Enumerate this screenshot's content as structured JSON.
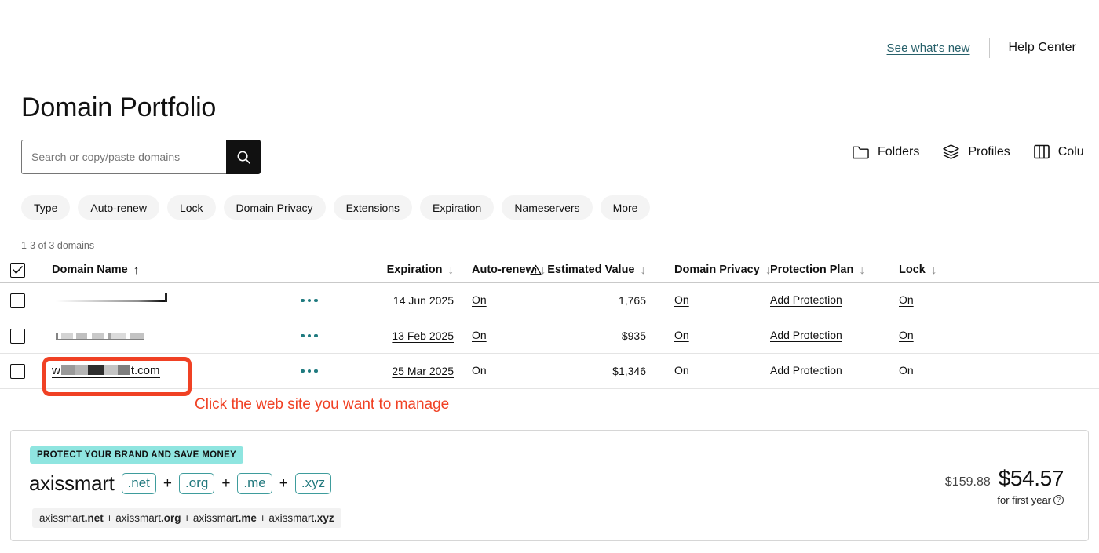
{
  "topbar": {
    "see_whats_new": "See what's new",
    "help_center": "Help Center"
  },
  "page_title": "Domain Portfolio",
  "search": {
    "placeholder": "Search or copy/paste domains",
    "value": "",
    "icon": "search-icon"
  },
  "actions": [
    {
      "label": "Folders",
      "icon": "folder-icon"
    },
    {
      "label": "Profiles",
      "icon": "layers-icon"
    },
    {
      "label": "Colu",
      "icon": "columns-icon"
    }
  ],
  "filter_chips": [
    "Type",
    "Auto-renew",
    "Lock",
    "Domain Privacy",
    "Extensions",
    "Expiration",
    "Nameservers",
    "More"
  ],
  "results_count": "1-3 of 3 domains",
  "table": {
    "headers": [
      {
        "label": "Domain Name",
        "sort": "↑",
        "sort_active": true
      },
      {
        "label": "Expiration",
        "sort": "↓",
        "sort_active": false
      },
      {
        "label": "Auto-renew",
        "sort": "↓",
        "sort_active": false
      },
      {
        "label": "Estimated Value",
        "sort": "↓",
        "sort_active": false,
        "icon": "warning-triangle-icon"
      },
      {
        "label": "Domain Privacy",
        "sort": "↓",
        "sort_active": false
      },
      {
        "label": "Protection Plan",
        "sort": "↓",
        "sort_active": false
      },
      {
        "label": "Lock",
        "sort": "↓",
        "sort_active": false
      }
    ],
    "rows": [
      {
        "domain": "",
        "domain_state": "redacted-faded",
        "expiration": "14 Jun 2025",
        "auto_renew": "On",
        "estimated_value": "1,765",
        "domain_privacy": "On",
        "protection_plan": "Add Protection",
        "lock": "On"
      },
      {
        "domain": "",
        "domain_state": "redacted-faint",
        "expiration": "13 Feb 2025",
        "auto_renew": "On",
        "estimated_value": "$935",
        "domain_privacy": "On",
        "protection_plan": "Add Protection",
        "lock": "On"
      },
      {
        "domain_prefix": "w",
        "domain_suffix": "t.com",
        "domain_state": "redacted-blocks",
        "expiration": "25 Mar 2025",
        "auto_renew": "On",
        "estimated_value": "$1,346",
        "domain_privacy": "On",
        "protection_plan": "Add Protection",
        "lock": "On"
      }
    ]
  },
  "annotation": {
    "text": "Click the web site you want to manage",
    "color": "#F04124"
  },
  "promo": {
    "badge": "PROTECT YOUR BRAND AND SAVE MONEY",
    "brand": "axissmart",
    "tlds": [
      ".net",
      ".org",
      ".me",
      ".xyz"
    ],
    "separator": "+",
    "bundle_prefix_1": "axissmart",
    "bundle_tld_1": ".net",
    "bundle_prefix_2": "axissmart",
    "bundle_tld_2": ".org",
    "bundle_prefix_3": "axissmart",
    "bundle_tld_3": ".me",
    "bundle_prefix_4": "axissmart",
    "bundle_tld_4": ".xyz",
    "price_old": "$159.88",
    "price_new": "$54.57",
    "price_note": "for first year",
    "badge_color": "#8FE5E0",
    "tld_color": "#22797E"
  }
}
